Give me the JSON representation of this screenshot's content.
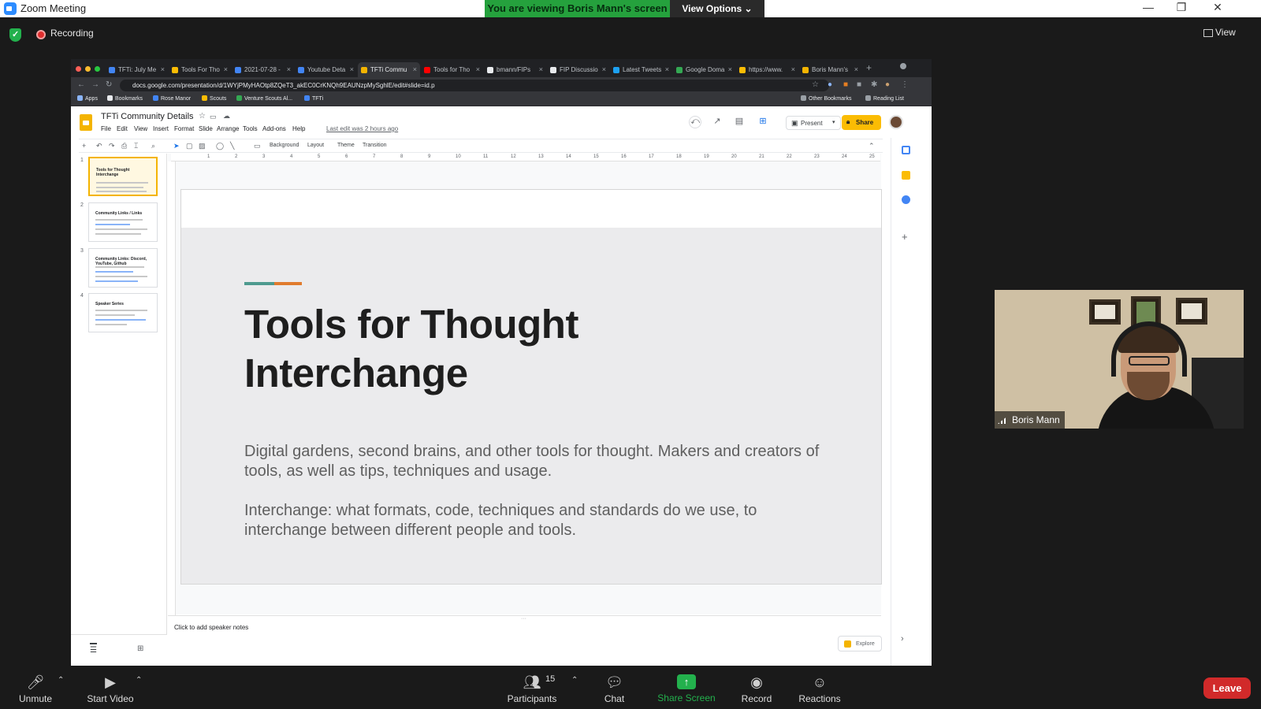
{
  "zoom": {
    "window_title": "Zoom Meeting",
    "viewing_banner": "You are viewing Boris Mann's screen",
    "view_options": "View Options",
    "recording_label": "Recording",
    "view_label": "View",
    "participant_name": "Boris Mann",
    "participants_count": "15",
    "controls": {
      "unmute": "Unmute",
      "start_video": "Start Video",
      "participants": "Participants",
      "chat": "Chat",
      "share_screen": "Share Screen",
      "record": "Record",
      "reactions": "Reactions",
      "leave": "Leave"
    },
    "colors": {
      "banner": "#25a13d",
      "leave": "#d12a2a",
      "share": "#23b14d"
    }
  },
  "browser": {
    "tabs": [
      {
        "label": "TFTi: July Me",
        "icon": "docs-icon"
      },
      {
        "label": "Tools For Tho",
        "icon": "drive-icon"
      },
      {
        "label": "2021-07-28 -",
        "icon": "docs-icon"
      },
      {
        "label": "Youtube Deta",
        "icon": "docs-icon"
      },
      {
        "label": "TFTi Commu",
        "icon": "slides-icon"
      },
      {
        "label": "Tools for Tho",
        "icon": "youtube-icon"
      },
      {
        "label": "bmann/FIPs",
        "icon": "github-icon"
      },
      {
        "label": "FIP Discussio",
        "icon": "github-icon"
      },
      {
        "label": "Latest Tweets",
        "icon": "twitter-icon"
      },
      {
        "label": "Google Doma",
        "icon": "google-icon"
      },
      {
        "label": "https://www.",
        "icon": "drive-icon"
      },
      {
        "label": "Boris Mann's",
        "icon": "slides-icon"
      }
    ],
    "url": "docs.google.com/presentation/d/1WYjPMyHAOtp8ZQeT3_akEC0CrKNQh9EAUNzpMySghlE/edit#slide=id.p",
    "bookmarks": [
      "Apps",
      "Bookmarks",
      "Rose Manor",
      "Scouts",
      "Venture Scouts Al...",
      "TFTi"
    ],
    "other_bookmarks": "Other Bookmarks",
    "reading_list": "Reading List"
  },
  "slides": {
    "doc_title": "TFTi Community Details",
    "menu": [
      "File",
      "Edit",
      "View",
      "Insert",
      "Format",
      "Slide",
      "Arrange",
      "Tools",
      "Add-ons",
      "Help"
    ],
    "last_edit": "Last edit was 2 hours ago",
    "present": "Present",
    "share": "Share",
    "toolbar": [
      "Background",
      "Layout",
      "Theme",
      "Transition"
    ],
    "ruler_ticks": [
      "1",
      "2",
      "3",
      "4",
      "5",
      "6",
      "7",
      "8",
      "9",
      "10",
      "11",
      "12",
      "13",
      "14",
      "15",
      "16",
      "17",
      "18",
      "19",
      "20",
      "21",
      "22",
      "23",
      "24",
      "25"
    ],
    "thumbnails": [
      {
        "num": "1",
        "title": "Tools for Thought Interchange"
      },
      {
        "num": "2",
        "title": "Community Links / Links"
      },
      {
        "num": "3",
        "title": "Community Links: Discord, YouTube, Github"
      },
      {
        "num": "4",
        "title": "Speaker Series"
      }
    ],
    "slide_title": "Tools for Thought Interchange",
    "slide_body_1": "Digital gardens, second brains, and other tools for thought. Makers and creators of tools, as well as tips, techniques and usage.",
    "slide_body_2": "Interchange: what formats, code, techniques and standards do we use, to interchange between different people and tools.",
    "speaker_notes_placeholder": "Click to add speaker notes",
    "explore": "Explore",
    "accent_colors": [
      "#4e9a8f",
      "#e07b2e"
    ]
  }
}
